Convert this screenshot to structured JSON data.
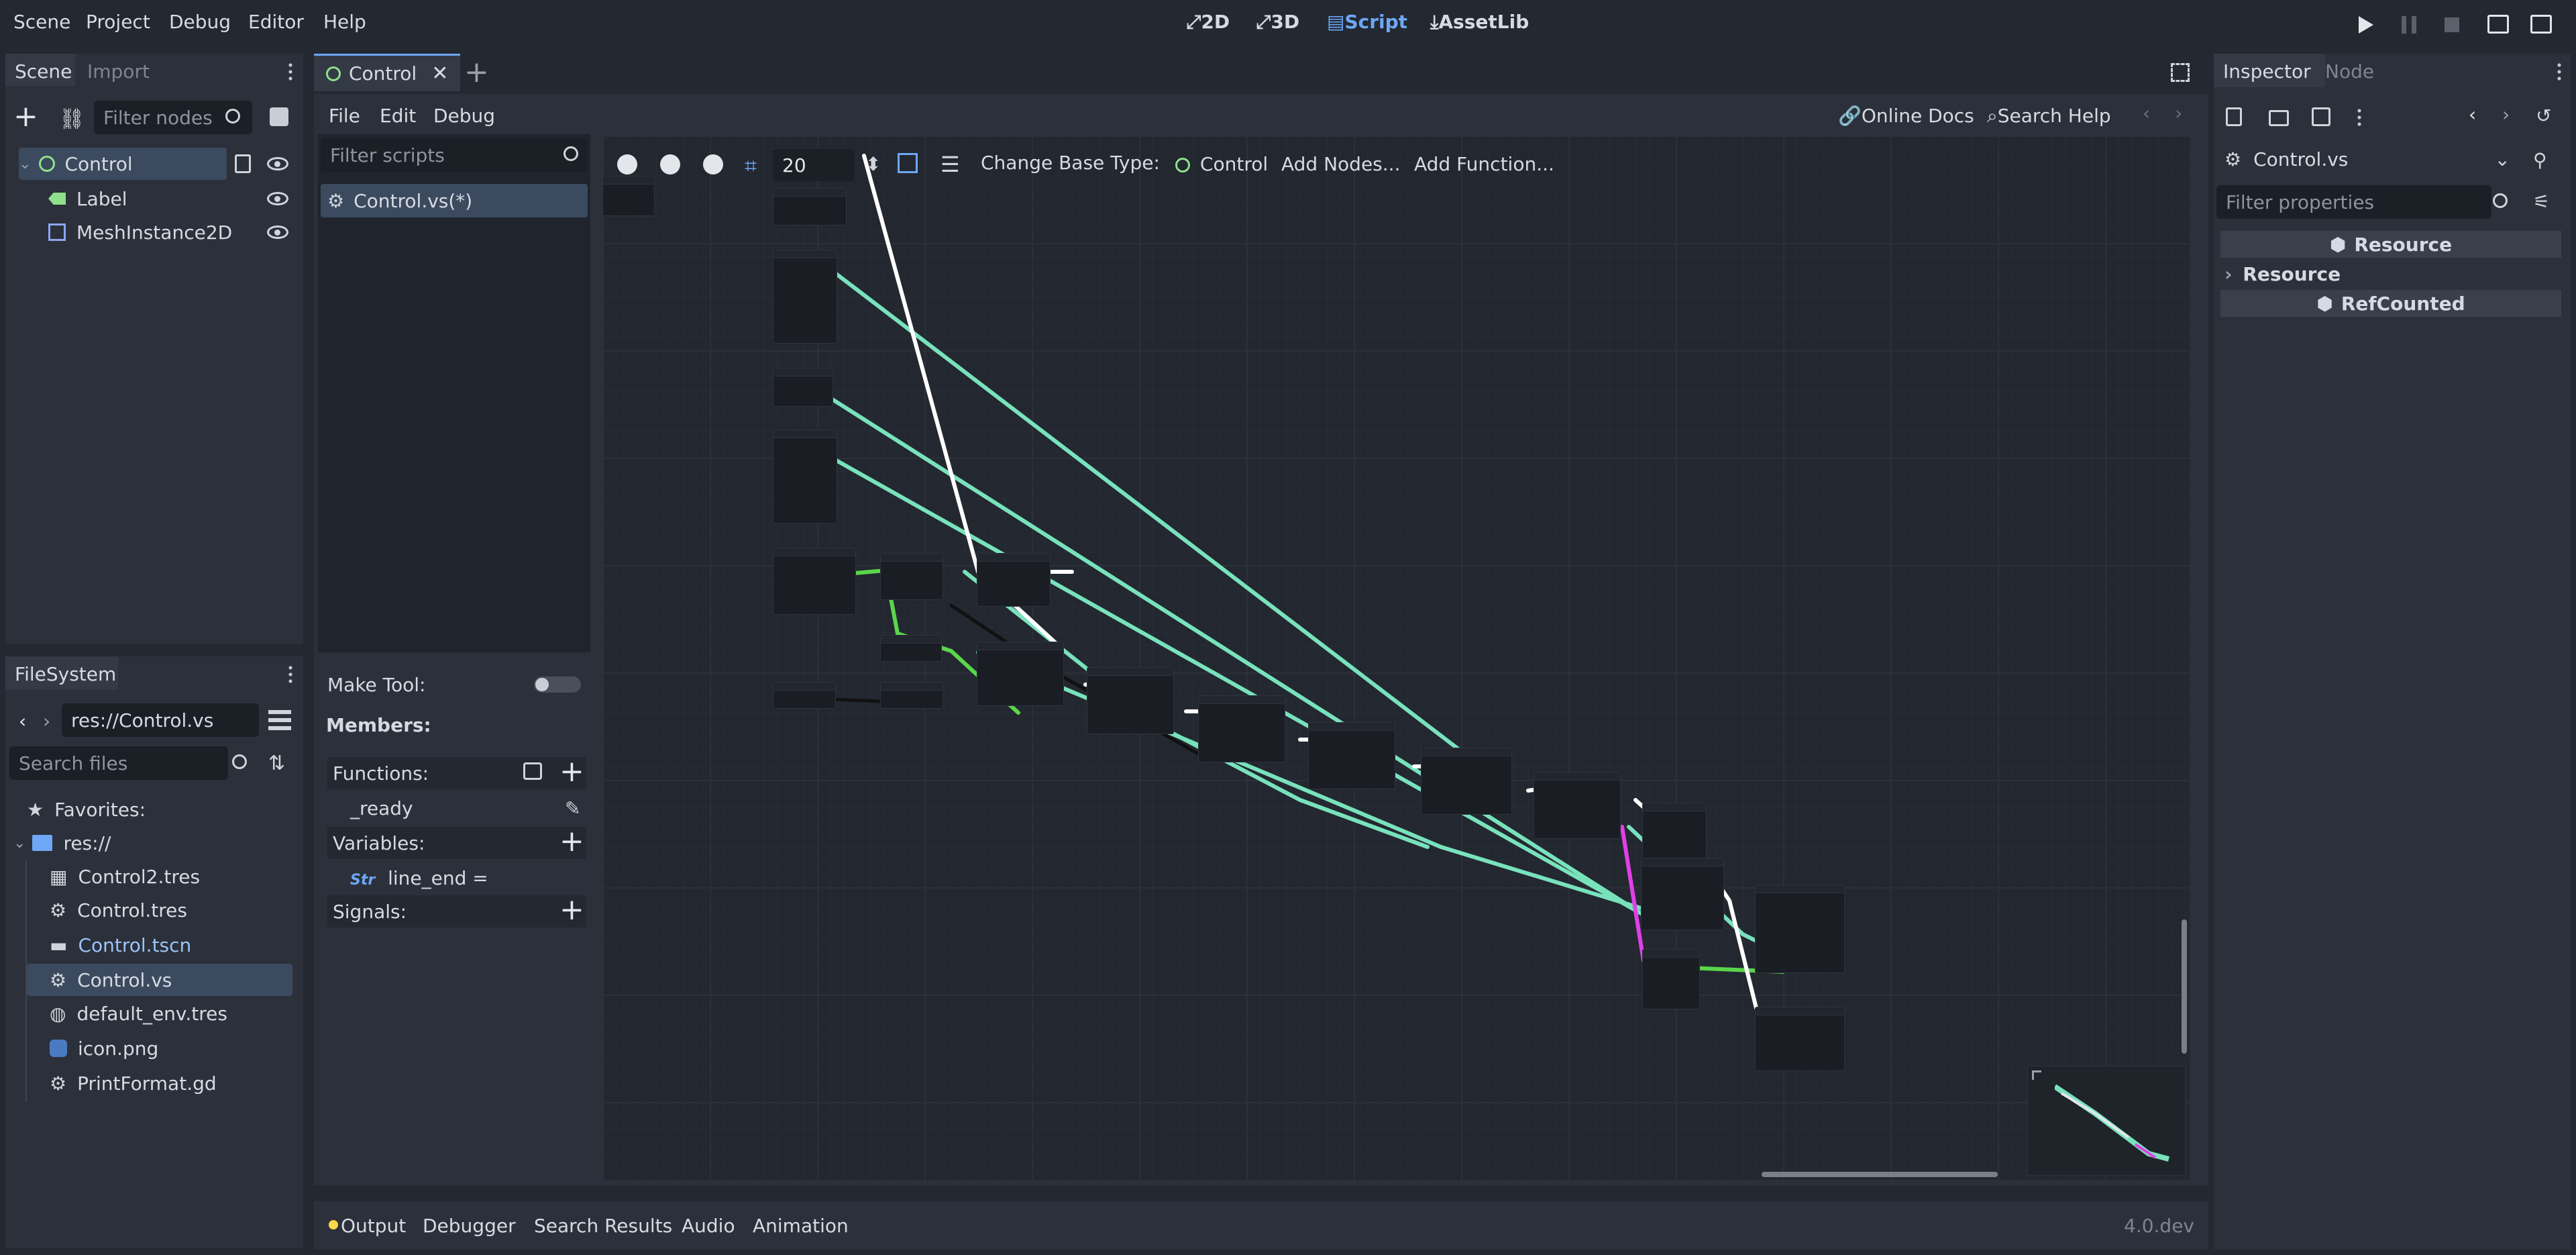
{
  "menu": [
    "Scene",
    "Project",
    "Debug",
    "Editor",
    "Help"
  ],
  "workspaces": {
    "w2d": "2D",
    "w3d": "3D",
    "script": "Script",
    "assetlib": "AssetLib"
  },
  "left_top": {
    "tabs": {
      "scene": "Scene",
      "import": "Import"
    },
    "filter_placeholder": "Filter nodes",
    "nodes": [
      "Control",
      "Label",
      "MeshInstance2D"
    ]
  },
  "filesystem": {
    "tab": "FileSystem",
    "path": "res://Control.vs",
    "search_placeholder": "Search files",
    "items": {
      "favorites": "Favorites:",
      "root": "res://",
      "files": [
        "Control2.tres",
        "Control.tres",
        "Control.tscn",
        "Control.vs",
        "default_env.tres",
        "icon.png",
        "PrintFormat.gd"
      ]
    }
  },
  "editor": {
    "scene_tab": "Control",
    "script_menu": [
      "File",
      "Edit",
      "Debug"
    ],
    "online_docs": "Online Docs",
    "search_help": "Search Help",
    "filter_scripts_placeholder": "Filter scripts",
    "script_item": "Control.vs(*)",
    "make_tool": "Make Tool:",
    "members": "Members:",
    "functions": "Functions:",
    "function_ready": "_ready",
    "variables": "Variables:",
    "variable_line_end": "line_end =",
    "signals": "Signals:",
    "zoom_value": "20",
    "change_base_type": "Change Base Type:",
    "base_type": "Control",
    "add_nodes": "Add Nodes...",
    "add_function": "Add Function..."
  },
  "bottom": {
    "tabs": [
      "Output",
      "Debugger",
      "Search Results",
      "Audio",
      "Animation"
    ],
    "version": "4.0.dev"
  },
  "inspector": {
    "tabs": {
      "inspector": "Inspector",
      "node": "Node"
    },
    "resource_name": "Control.vs",
    "filter_placeholder": "Filter properties",
    "section_resource": "Resource",
    "group_resource": "Resource",
    "section_refcounted": "RefCounted"
  },
  "colors": {
    "accent": "#6ea7f5",
    "wire_green": "#78e2bc",
    "wire_white": "#ffffff",
    "wire_magenta": "#e040e6",
    "wire_black": "#000000",
    "node_green": "#8ee08a"
  }
}
